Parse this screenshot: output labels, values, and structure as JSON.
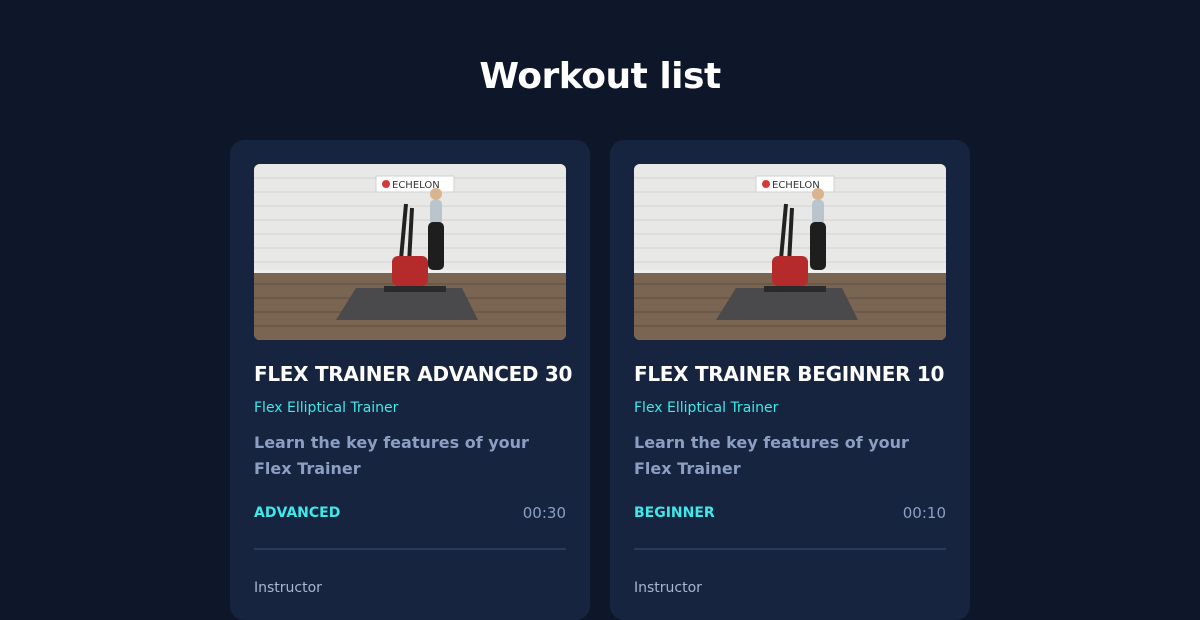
{
  "page": {
    "title": "Workout list"
  },
  "workouts": [
    {
      "title": "FLEX TRAINER ADVANCED 30",
      "equipment": "Flex Elliptical Trainer",
      "description": "Learn the key features of your Flex Trainer",
      "level": "ADVANCED",
      "duration": "00:30",
      "instructor_label": "Instructor",
      "thumbnail": {
        "brand_sign": "ECHELON"
      }
    },
    {
      "title": "FLEX TRAINER BEGINNER 10",
      "equipment": "Flex Elliptical Trainer",
      "description": "Learn the key features of your Flex Trainer",
      "level": "BEGINNER",
      "duration": "00:10",
      "instructor_label": "Instructor",
      "thumbnail": {
        "brand_sign": "ECHELON"
      }
    }
  ],
  "colors": {
    "background": "#0e1729",
    "card": "#16243f",
    "accent": "#3ee9ea",
    "muted": "#8c9fc3"
  }
}
